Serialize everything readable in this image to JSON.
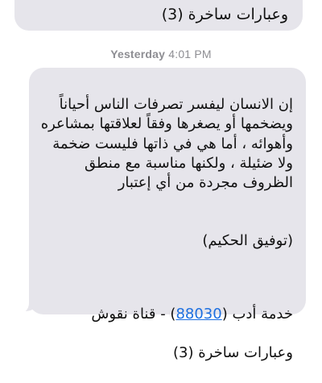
{
  "thread": {
    "previous_message": {
      "last_line": "وعبارات ساخرة (3)"
    },
    "timestamp": {
      "day": "Yesterday",
      "time": "4:01 PM"
    },
    "message": {
      "body": "إن الانسان ليفسر تصرفات الناس أحياناً ويضخمها أو يصغرها وفقاً لعلاقتها بمشاعره وأهوائه ، أما هي في ذاتها فليست ضخمة ولا ضئيلة ، ولكنها مناسبة مع منطق الظروف مجردة من أي إعتبار",
      "signature": "(توفيق الحكيم)",
      "service_prefix": "خدمة أدب (",
      "service_number": "88030",
      "service_suffix": ") - قناة نقوش",
      "service_last_line": "وعبارات ساخرة (3)"
    }
  }
}
